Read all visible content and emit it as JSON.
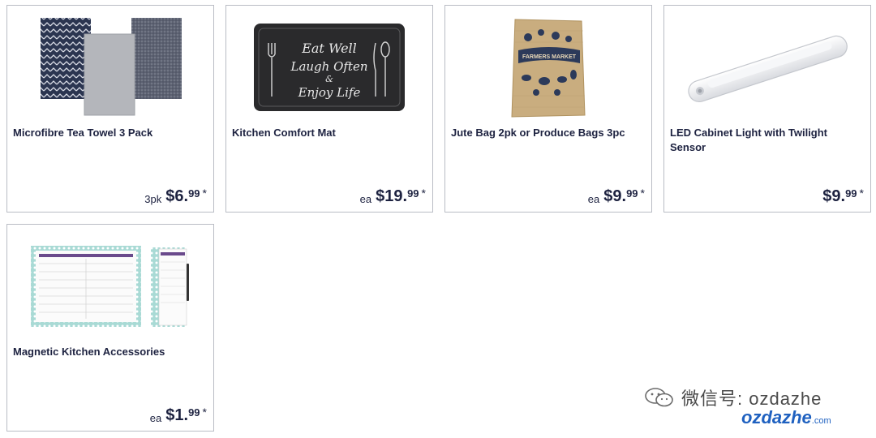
{
  "products": [
    {
      "title": "Microfibre Tea Towel 3 Pack",
      "unit": "3pk",
      "dollars": "$6.",
      "cents": "99",
      "asterisk": "*",
      "image": "tea-towels"
    },
    {
      "title": "Kitchen Comfort Mat",
      "unit": "ea",
      "dollars": "$19.",
      "cents": "99",
      "asterisk": "*",
      "image": "comfort-mat",
      "mat_text": [
        "Eat Well",
        "Laugh Often",
        "&",
        "Enjoy Life"
      ]
    },
    {
      "title": "Jute Bag 2pk or Produce Bags 3pc",
      "unit": "ea",
      "dollars": "$9.",
      "cents": "99",
      "asterisk": "*",
      "image": "jute-bag",
      "bag_text": "FARMERS MARKET"
    },
    {
      "title": "LED Cabinet Light with Twilight Sensor",
      "unit": "",
      "dollars": "$9.",
      "cents": "99",
      "asterisk": "*",
      "image": "led-light"
    },
    {
      "title": "Magnetic Kitchen Accessories",
      "unit": "ea",
      "dollars": "$1.",
      "cents": "99",
      "asterisk": "*",
      "image": "magnetic-planner"
    }
  ],
  "watermark": {
    "wechat_label": "微信号: ozdazhe",
    "brand": "ozdazhe",
    "brand_suffix": ".com"
  },
  "colors": {
    "text": "#1d2240",
    "border": "#b9bcc5",
    "brand_blue": "#1f61c0",
    "brand_orange": "#f0a030"
  }
}
